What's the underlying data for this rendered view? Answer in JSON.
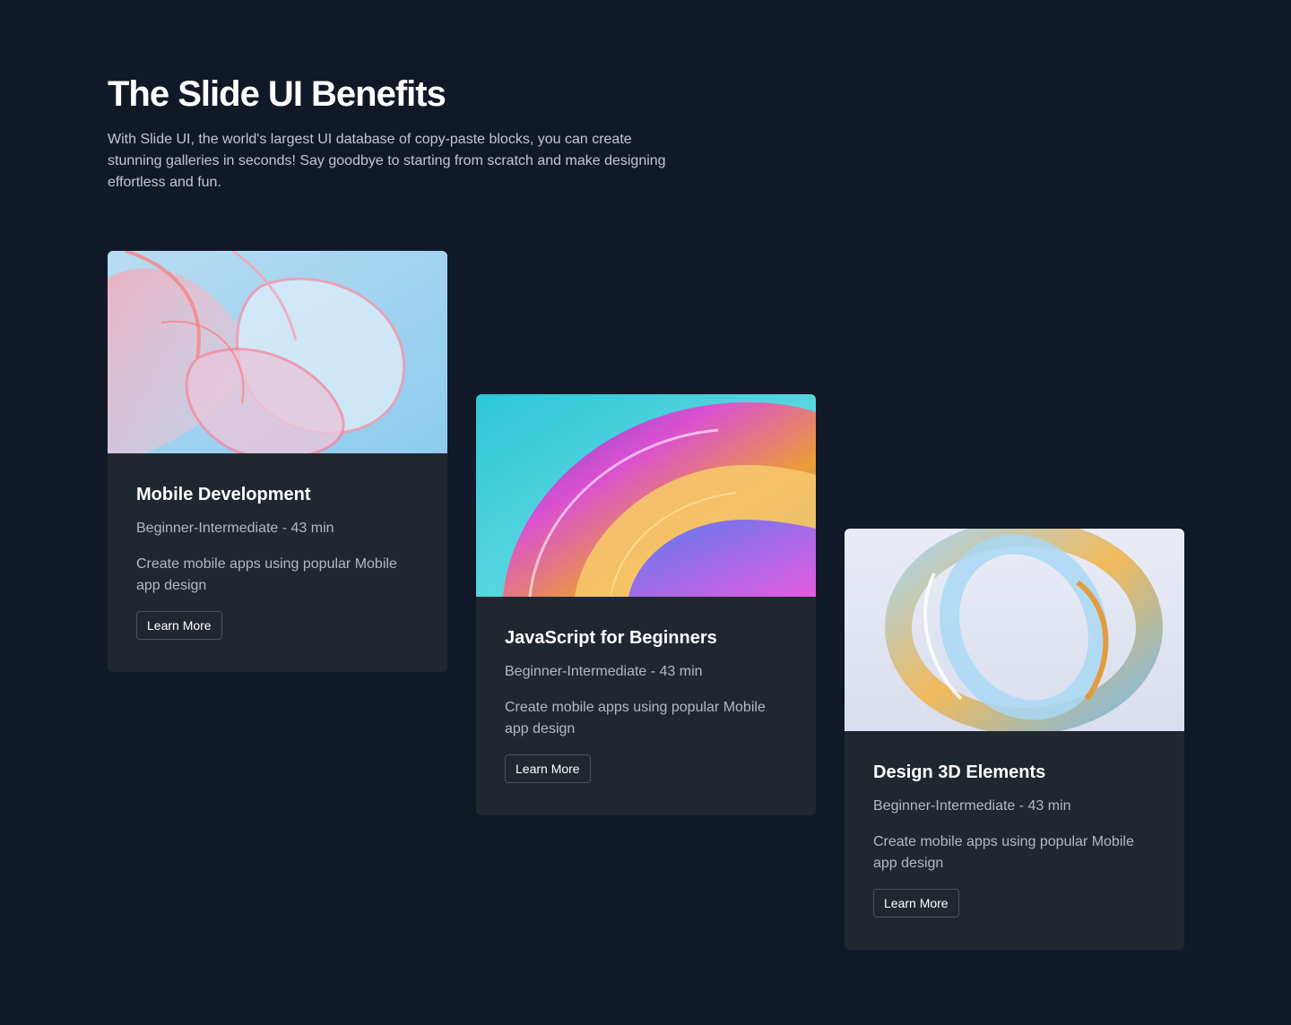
{
  "header": {
    "title": "The Slide UI Benefits",
    "description": "With Slide UI, the world's largest UI database of copy-paste blocks, you can create stunning galleries in seconds! Say goodbye to starting from scratch and make designing effortless and fun."
  },
  "cards": [
    {
      "title": "Mobile Development",
      "meta": "Beginner-Intermediate - 43 min",
      "description": "Create mobile apps using popular Mobile app design",
      "button_label": "Learn More"
    },
    {
      "title": "JavaScript for Beginners",
      "meta": "Beginner-Intermediate - 43 min",
      "description": "Create mobile apps using popular Mobile app design",
      "button_label": "Learn More"
    },
    {
      "title": "Design 3D Elements",
      "meta": "Beginner-Intermediate - 43 min",
      "description": "Create mobile apps using popular Mobile app design",
      "button_label": "Learn More"
    }
  ],
  "colors": {
    "background": "#111827",
    "card_background": "#21272f",
    "button_border": "#4b5260",
    "muted_text": "#b4b9c1"
  }
}
